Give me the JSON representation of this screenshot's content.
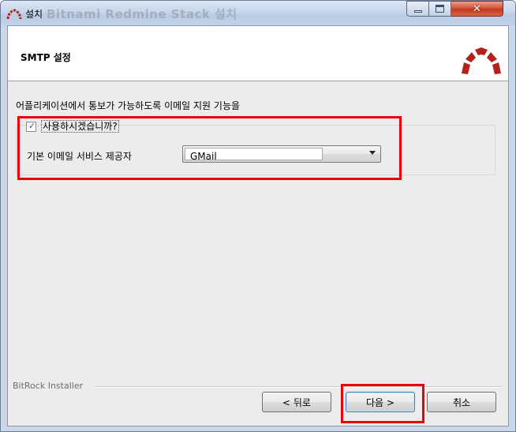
{
  "window": {
    "title": "설치",
    "title_ghost": "Bitnami Redmine Stack 설치",
    "controls": {
      "minimize": "minimize",
      "maximize": "maximize",
      "close": "✕"
    }
  },
  "header": {
    "title": "SMTP 설정",
    "logo_icon": "redmine-logo-icon"
  },
  "content": {
    "description": "어플리케이션에서 통보가 가능하도록 이메일 지원 기능을",
    "enable_checkbox": {
      "label": "사용하시겠습니까?",
      "checked": true,
      "mark": "✓"
    },
    "provider": {
      "label": "기본 이메일 서비스 제공자",
      "value": "GMail"
    }
  },
  "footer": {
    "installer_label": "BitRock Installer",
    "back_label": "< 뒤로",
    "next_label": "다음 >",
    "cancel_label": "취소"
  },
  "colors": {
    "highlight": "#e8000d",
    "logo_red": "#b3211a",
    "close_red": "#c23b1f"
  }
}
